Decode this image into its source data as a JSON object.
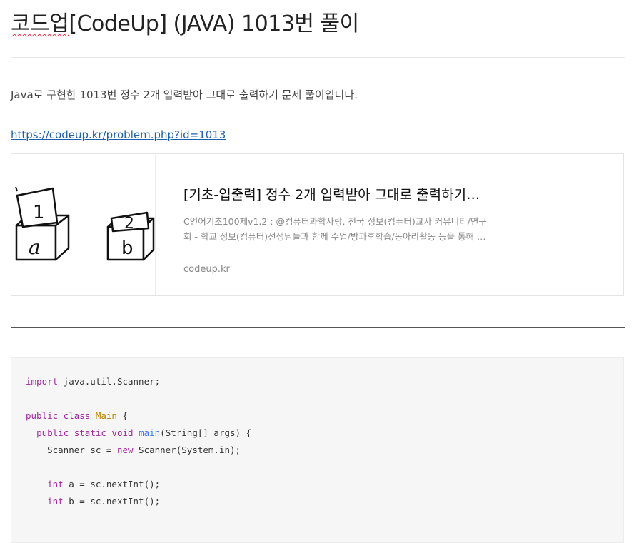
{
  "post": {
    "title_underlined": "코드업",
    "title_rest": "[CodeUp] (JAVA) 1013번 풀이",
    "intro": "Java로 구현한 1013번 정수 2개 입력받아 그대로 출력하기 문제 풀이입니다.",
    "link": "https://codeup.kr/problem.php?id=1013"
  },
  "card": {
    "title": "[기초-입출력] 정수 2개 입력받아 그대로 출력하기…",
    "desc_line1": "C언어기초100제v1.2 : @컴퓨터과학사랑, 전국 정보(컴퓨터)교사 커뮤니티/연구",
    "desc_line2": "회 - 학교 정보(컴퓨터)선생님들과 함께 수업/방과후학습/동아리활동 등을 통해 …",
    "host": "codeup.kr",
    "thumb": {
      "box1_note": "1",
      "box1_label": "a",
      "box2_note": "2",
      "box2_label": "b"
    }
  },
  "code": {
    "l1_kw": "import",
    "l1_rest": " java.util.Scanner;",
    "l3_kw": "public class",
    "l3_cls": "Main",
    "l3_rest": " {",
    "l4_kw": "public static void",
    "l4_fn": "main",
    "l4_rest": "(String[] args) {",
    "l5_a": "Scanner sc = ",
    "l5_kw": "new",
    "l5_b": " Scanner(System.in);",
    "l7_kw": "int",
    "l7_rest": " a = sc.nextInt();",
    "l8_kw": "int",
    "l8_rest": " b = sc.nextInt();"
  }
}
